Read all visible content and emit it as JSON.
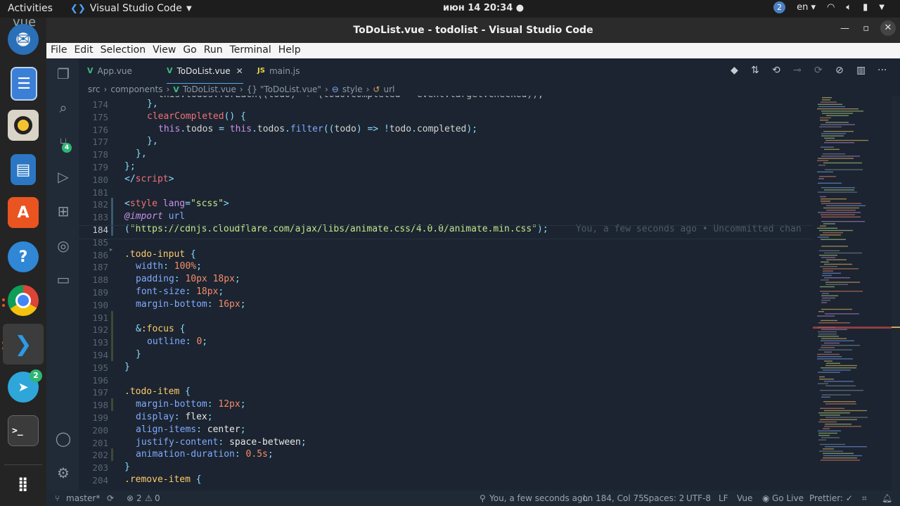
{
  "topbar": {
    "activities": "Activities",
    "app_name": "Visual Studio Code",
    "clock": "июн 14  20:34 ●",
    "notifications": "2",
    "language": "en ▾"
  },
  "dock": {
    "items": [
      {
        "name": "Thunderbird"
      },
      {
        "name": "Files"
      },
      {
        "name": "Rhythmbox"
      },
      {
        "name": "LibreOffice Writer"
      },
      {
        "name": "Ubuntu Software"
      },
      {
        "name": "Help"
      },
      {
        "name": "Google Chrome"
      },
      {
        "name": "Visual Studio Code"
      },
      {
        "name": "Telegram",
        "badge": "2"
      },
      {
        "name": "Terminal"
      },
      {
        "name": "Show Applications"
      }
    ],
    "trash_label": "vue"
  },
  "window": {
    "title": "ToDoList.vue - todolist - Visual Studio Code",
    "menu": [
      "File",
      "Edit",
      "Selection",
      "View",
      "Go",
      "Run",
      "Terminal",
      "Help"
    ]
  },
  "activitybar": {
    "scm_badge": "4"
  },
  "tabs": [
    {
      "label": "App.vue",
      "type": "V"
    },
    {
      "label": "ToDoList.vue",
      "type": "V",
      "active": true
    },
    {
      "label": "main.js",
      "type": "JS"
    }
  ],
  "breadcrumb": [
    "src",
    "components",
    "ToDoList.vue",
    "{} \"ToDoList.vue\"",
    "style",
    "url"
  ],
  "editor": {
    "lines": [
      {
        "n": "174",
        "h": "<span class=\"c-punc\">},</span>"
      },
      {
        "n": "175",
        "h": "<span class=\"c-fn\">clearCompleted</span><span class=\"c-punc\">() {</span>"
      },
      {
        "n": "176",
        "h": "<span class=\"c-this\">this</span><span class=\"c-punc\">.</span>todos <span class=\"c-punc\">=</span> <span class=\"c-this\">this</span><span class=\"c-punc\">.</span>todos<span class=\"c-punc\">.</span><span class=\"c-prop\">filter</span><span class=\"c-punc\">((</span>todo<span class=\"c-punc\">) =&gt; !</span>todo<span class=\"c-punc\">.</span>completed<span class=\"c-punc\">);</span>"
      },
      {
        "n": "177",
        "h": "<span class=\"c-punc\">},</span>"
      },
      {
        "n": "178",
        "h": "<span class=\"c-punc\">},</span>"
      },
      {
        "n": "179",
        "h": "<span class=\"c-punc\">};</span>"
      },
      {
        "n": "180",
        "h": "<span class=\"c-punc\">&lt;/</span><span class=\"c-tag\">script</span><span class=\"c-punc\">&gt;</span>"
      },
      {
        "n": "181",
        "h": ""
      },
      {
        "n": "182",
        "h": "<span class=\"c-punc\">&lt;</span><span class=\"c-tag\">style</span> <span class=\"c-attr\">lang</span><span class=\"c-punc\">=</span><span class=\"c-str\">\"scss\"</span><span class=\"c-punc\">&gt;</span>"
      },
      {
        "n": "183",
        "h": "<span class=\"c-kw\">@import</span> <span class=\"c-prop\">url</span>"
      },
      {
        "n": "184",
        "h": "<span class=\"c-punc\">(</span><span class=\"c-str\">\"https://cdnjs.cloudflare.com/ajax/libs/animate.css/4.0.0/animate.min.css\"</span><span class=\"c-punc\">);</span>     <span class=\"c-blame\">You, a few seconds ago • Uncommitted chan</span>"
      },
      {
        "n": "185",
        "h": ""
      },
      {
        "n": "186",
        "h": "<span class=\"c-sel\">.todo-input</span> <span class=\"c-punc\">{</span>"
      },
      {
        "n": "187",
        "h": "<span class=\"c-key\">width</span><span class=\"c-punc\">:</span> <span class=\"c-num\">100%</span><span class=\"c-punc\">;</span>"
      },
      {
        "n": "188",
        "h": "<span class=\"c-key\">padding</span><span class=\"c-punc\">:</span> <span class=\"c-num\">10px</span> <span class=\"c-num\">18px</span><span class=\"c-punc\">;</span>"
      },
      {
        "n": "189",
        "h": "<span class=\"c-key\">font-size</span><span class=\"c-punc\">:</span> <span class=\"c-num\">18px</span><span class=\"c-punc\">;</span>"
      },
      {
        "n": "190",
        "h": "<span class=\"c-key\">margin-bottom</span><span class=\"c-punc\">:</span> <span class=\"c-num\">16px</span><span class=\"c-punc\">;</span>"
      },
      {
        "n": "191",
        "h": ""
      },
      {
        "n": "192",
        "h": "<span class=\"c-punc\">&amp;</span><span class=\"c-sel\">:focus</span> <span class=\"c-punc\">{</span>"
      },
      {
        "n": "193",
        "h": "<span class=\"c-key\">outline</span><span class=\"c-punc\">:</span> <span class=\"c-num\">0</span><span class=\"c-punc\">;</span>"
      },
      {
        "n": "194",
        "h": "<span class=\"c-punc\">}</span>"
      },
      {
        "n": "195",
        "h": "<span class=\"c-punc\">}</span>"
      },
      {
        "n": "196",
        "h": ""
      },
      {
        "n": "197",
        "h": "<span class=\"c-sel\">.todo-item</span> <span class=\"c-punc\">{</span>"
      },
      {
        "n": "198",
        "h": "<span class=\"c-key\">margin-bottom</span><span class=\"c-punc\">:</span> <span class=\"c-num\">12px</span><span class=\"c-punc\">;</span>"
      },
      {
        "n": "199",
        "h": "<span class=\"c-key\">display</span><span class=\"c-punc\">:</span> <span class=\"c-val\">flex</span><span class=\"c-punc\">;</span>"
      },
      {
        "n": "200",
        "h": "<span class=\"c-key\">align-items</span><span class=\"c-punc\">:</span> <span class=\"c-val\">center</span><span class=\"c-punc\">;</span>"
      },
      {
        "n": "201",
        "h": "<span class=\"c-key\">justify-content</span><span class=\"c-punc\">:</span> <span class=\"c-val\">space-between</span><span class=\"c-punc\">;</span>"
      },
      {
        "n": "202",
        "h": "<span class=\"c-key\">animation-duration</span><span class=\"c-punc\">:</span> <span class=\"c-num\">0.5s</span><span class=\"c-punc\">;</span>"
      },
      {
        "n": "203",
        "h": "<span class=\"c-punc\">}</span>"
      },
      {
        "n": "204",
        "h": "<span class=\"c-sel\">.remove-item</span> <span class=\"c-punc\">{</span>"
      }
    ]
  },
  "statusbar": {
    "branch": "master*",
    "errors": "2",
    "warnings": "0",
    "blame": "You, a few seconds ago",
    "position": "Ln 184, Col 75",
    "spaces": "Spaces: 2",
    "encoding": "UTF-8",
    "eol": "LF",
    "language": "Vue",
    "golive": "Go Live",
    "prettier": "Prettier: ✓"
  },
  "colors": {
    "accent": "#5aa9e6",
    "vue": "#41b883",
    "editor_bg": "#1b2430"
  }
}
